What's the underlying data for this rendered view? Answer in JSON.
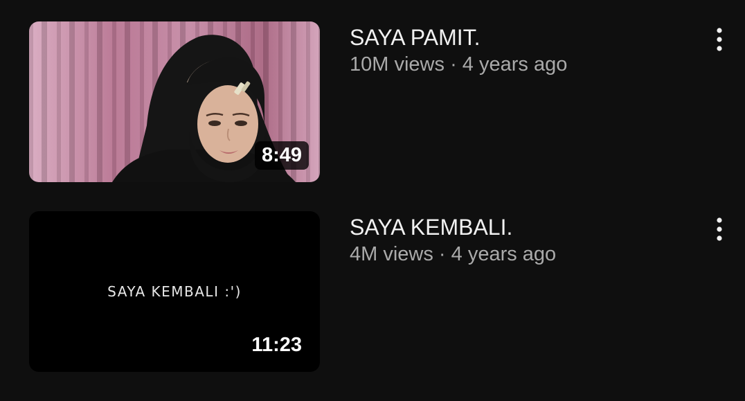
{
  "videos": [
    {
      "title": "SAYA PAMIT.",
      "views": "10M views",
      "separator": "·",
      "age": "4 years ago",
      "duration": "8:49",
      "thumbnail_text": "",
      "more_icon": "more-vert-icon"
    },
    {
      "title": "SAYA KEMBALI.",
      "views": "4M views",
      "separator": "·",
      "age": "4 years ago",
      "duration": "11:23",
      "thumbnail_text": "SAYA KEMBALI :')",
      "more_icon": "more-vert-icon"
    }
  ],
  "colors": {
    "background": "#0f0f0f",
    "title": "#f1f1f1",
    "meta": "#aaaaaa"
  }
}
